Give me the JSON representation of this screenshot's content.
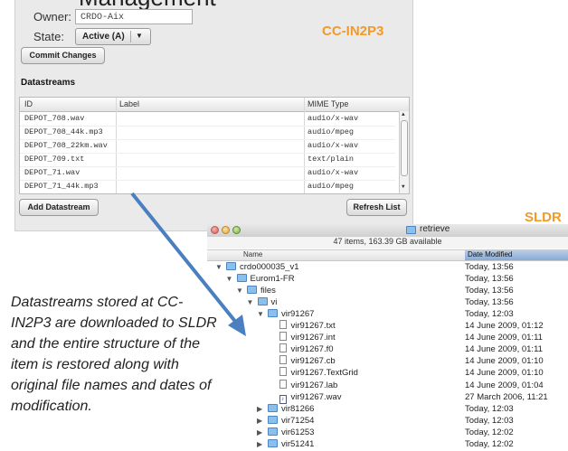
{
  "fedora_panel": {
    "cut_heading": "Management",
    "owner_label": "Owner:",
    "owner_value": "CRDO-Aix",
    "state_label": "State:",
    "state_value": "Active (A)",
    "commit_label": "Commit Changes",
    "institution_tag": "CC-IN2P3",
    "section_title": "Datastreams",
    "columns": [
      "ID",
      "Label",
      "MIME Type"
    ],
    "rows": [
      {
        "id": "DEPOT_708.wav",
        "label": "",
        "mime": "audio/x-wav"
      },
      {
        "id": "DEPOT_708_44k.mp3",
        "label": "",
        "mime": "audio/mpeg"
      },
      {
        "id": "DEPOT_708_22km.wav",
        "label": "",
        "mime": "audio/x-wav"
      },
      {
        "id": "DEPOT_709.txt",
        "label": "",
        "mime": "text/plain"
      },
      {
        "id": "DEPOT_71.wav",
        "label": "",
        "mime": "audio/x-wav"
      },
      {
        "id": "DEPOT_71_44k.mp3",
        "label": "",
        "mime": "audio/mpeg"
      }
    ],
    "add_label": "Add Datastream",
    "refresh_label": "Refresh List"
  },
  "finder": {
    "repository_tag": "SLDR",
    "title": "retrieve",
    "status": "47 items, 163.39 GB available",
    "col_name": "Name",
    "col_date": "Date Modified",
    "items": [
      {
        "name": "crdo000035_v1",
        "date": "Today, 13:56",
        "kind": "folder",
        "level": 0,
        "open": true
      },
      {
        "name": "Eurom1-FR",
        "date": "Today, 13:56",
        "kind": "folder",
        "level": 1,
        "open": true
      },
      {
        "name": "files",
        "date": "Today, 13:56",
        "kind": "folder",
        "level": 2,
        "open": true
      },
      {
        "name": "vi",
        "date": "Today, 13:56",
        "kind": "folder",
        "level": 3,
        "open": true
      },
      {
        "name": "vir91267",
        "date": "Today, 12:03",
        "kind": "folder",
        "level": 4,
        "open": true
      },
      {
        "name": "vir91267.txt",
        "date": "14 June 2009, 01:12",
        "kind": "file",
        "level": 5
      },
      {
        "name": "vir91267.int",
        "date": "14 June 2009, 01:11",
        "kind": "file",
        "level": 5
      },
      {
        "name": "vir91267.f0",
        "date": "14 June 2009, 01:11",
        "kind": "file",
        "level": 5
      },
      {
        "name": "vir91267.cb",
        "date": "14 June 2009, 01:10",
        "kind": "file",
        "level": 5
      },
      {
        "name": "vir91267.TextGrid",
        "date": "14 June 2009, 01:10",
        "kind": "file",
        "level": 5
      },
      {
        "name": "vir91267.lab",
        "date": "14 June 2009, 01:04",
        "kind": "file",
        "level": 5
      },
      {
        "name": "vir91267.wav",
        "date": "27 March 2006, 11:21",
        "kind": "wav",
        "level": 5
      },
      {
        "name": "vir81266",
        "date": "Today, 12:03",
        "kind": "folder",
        "level": 4,
        "open": false
      },
      {
        "name": "vir71254",
        "date": "Today, 12:03",
        "kind": "folder",
        "level": 4,
        "open": false
      },
      {
        "name": "vir61253",
        "date": "Today, 12:02",
        "kind": "folder",
        "level": 4,
        "open": false
      },
      {
        "name": "vir51241",
        "date": "Today, 12:02",
        "kind": "folder",
        "level": 4,
        "open": false
      }
    ]
  },
  "caption": "Datastreams stored at CC-IN2P3 are downloaded to SLDR and the entire structure of the item is restored along with original file names and dates of modification.",
  "colors": {
    "accent": "#f39a26",
    "arrow": "#4a7fc0",
    "selected_column": "#8aaad4"
  }
}
